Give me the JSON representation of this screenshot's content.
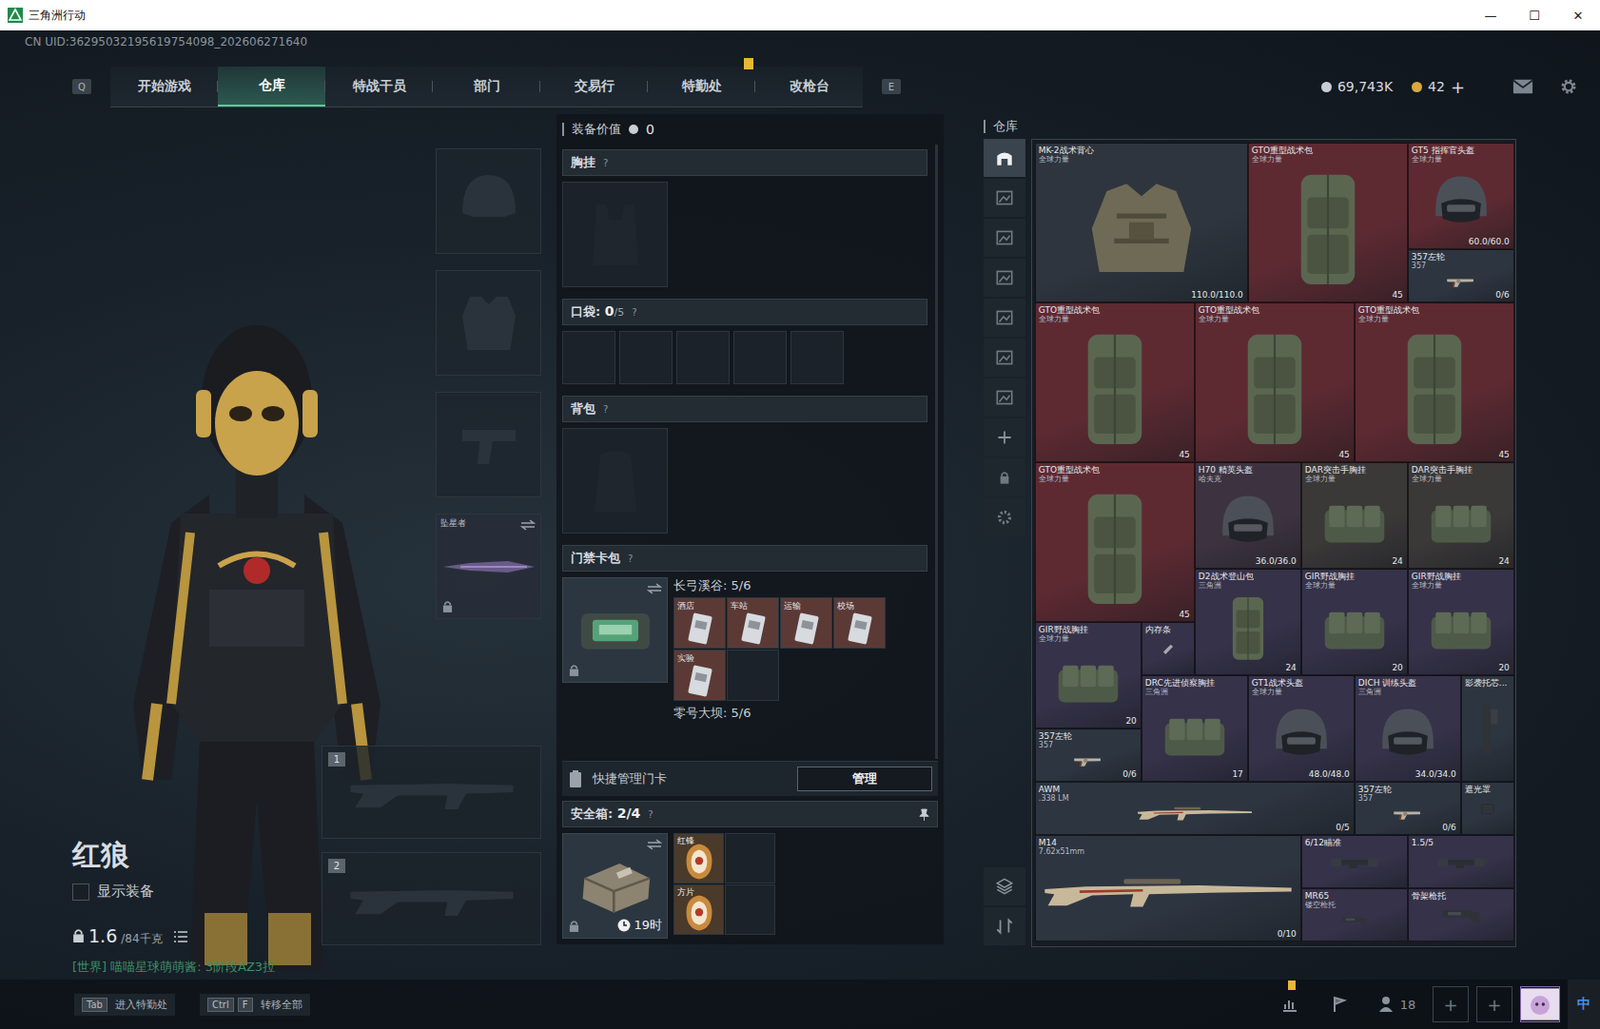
{
  "window": {
    "title": "三角洲行动",
    "controls": [
      "—",
      "☐",
      "✕"
    ]
  },
  "uid": "CN UID:36295032195619754098_202606271640",
  "nav": {
    "keys": [
      "Q",
      "E"
    ],
    "tabs": [
      {
        "label": "开始游戏",
        "selected": false,
        "alert": false
      },
      {
        "label": "仓库",
        "selected": true,
        "alert": false
      },
      {
        "label": "特战干员",
        "selected": false,
        "alert": false
      },
      {
        "label": "部门",
        "selected": false,
        "alert": false
      },
      {
        "label": "交易行",
        "selected": false,
        "alert": false
      },
      {
        "label": "特勤处",
        "selected": false,
        "alert": true
      },
      {
        "label": "改枪台",
        "selected": false,
        "alert": false
      }
    ]
  },
  "currency": {
    "coins": "69,743K",
    "tickets": "42",
    "add": "+"
  },
  "character": {
    "name": "红狼",
    "show_equipment": {
      "label": "显示装备",
      "checked": false
    },
    "weight": "1.6",
    "weight_max": "/84千克",
    "chat": "[世界] 喵喵星球萌萌酱: 3阶段AZ3拉"
  },
  "equip_slots": [
    {
      "kind": "helmet",
      "label": "",
      "locked": false,
      "swap": false
    },
    {
      "kind": "armor",
      "label": "",
      "locked": false,
      "swap": false
    },
    {
      "kind": "pistol",
      "label": "",
      "locked": false,
      "swap": false
    },
    {
      "kind": "melee",
      "label": "坠星者",
      "locked": true,
      "swap": true
    }
  ],
  "weapon_slots": [
    {
      "number": "1"
    },
    {
      "number": "2"
    }
  ],
  "loadout": {
    "value_label": "装备价值",
    "value": "0",
    "chest": {
      "title": "胸挂",
      "help": "?"
    },
    "pockets": {
      "title": "口袋:",
      "count": "0",
      "max": "/5",
      "help": "?",
      "slots": 5
    },
    "backpack": {
      "title": "背包",
      "help": "?"
    },
    "keycards": {
      "title": "门禁卡包",
      "help": "?",
      "maps": [
        {
          "title": "长弓溪谷: 5/6",
          "cards": [
            {
              "label": "酒店",
              "owned": true
            },
            {
              "label": "车站",
              "owned": true
            },
            {
              "label": "运输",
              "owned": true
            },
            {
              "label": "校场",
              "owned": true
            },
            {
              "label": "实验",
              "owned": true
            },
            {
              "label": "",
              "owned": false
            }
          ]
        },
        {
          "title": "零号大坝: 5/6",
          "cards": []
        }
      ]
    },
    "quick": {
      "label": "快捷管理门卡",
      "button": "管理"
    },
    "safebox": {
      "title": "安全箱:",
      "count": "2/4",
      "help": "?",
      "timer": "19时",
      "items": [
        {
          "label": "红锋",
          "filled": true
        },
        {
          "label": "",
          "filled": false
        },
        {
          "label": "方片",
          "filled": true
        },
        {
          "label": "",
          "filled": false
        }
      ]
    }
  },
  "warehouse": {
    "title": "仓库",
    "tabs": [
      {
        "kind": "home",
        "selected": true
      },
      {
        "kind": "tab",
        "selected": false
      },
      {
        "kind": "tab",
        "selected": false
      },
      {
        "kind": "tab",
        "selected": false
      },
      {
        "kind": "tab",
        "selected": false
      },
      {
        "kind": "tab",
        "selected": false
      },
      {
        "kind": "tab",
        "selected": false
      },
      {
        "kind": "add",
        "selected": false
      },
      {
        "kind": "lock",
        "selected": false
      },
      {
        "kind": "settings",
        "selected": false
      }
    ],
    "items": [
      {
        "name": "MK-2战术背心",
        "sub": "全球力量",
        "stat": "110.0/110.0",
        "kind": "vest",
        "color": "#2e353e"
      },
      {
        "name": "GTO重型战术包",
        "sub": "全球力量",
        "stat": "45",
        "kind": "bag",
        "color": "#5e2a32"
      },
      {
        "name": "GT5 指挥官头盔",
        "sub": "全球力量",
        "stat": "60.0/60.0",
        "kind": "helmet",
        "color": "#5e2a32"
      },
      {
        "name": "357左轮",
        "sub": "357",
        "stat": "0/6",
        "kind": "pistol",
        "color": "#2d3540"
      },
      {
        "name": "GTO重型战术包",
        "sub": "全球力量",
        "stat": "45",
        "kind": "bag",
        "color": "#5e2a32"
      },
      {
        "name": "GTO重型战术包",
        "sub": "全球力量",
        "stat": "45",
        "kind": "bag",
        "color": "#5e2a32"
      },
      {
        "name": "GTO重型战术包",
        "sub": "全球力量",
        "stat": "45",
        "kind": "bag",
        "color": "#5e2a32"
      },
      {
        "name": "GTO重型战术包",
        "sub": "全球力量",
        "stat": "45",
        "kind": "bag",
        "color": "#5e2a32"
      },
      {
        "name": "H70 精英头盔",
        "sub": "哈夫克",
        "stat": "36.0/36.0",
        "kind": "helmet",
        "color": "#3d3340"
      },
      {
        "name": "DAR突击手胸挂",
        "sub": "全球力量",
        "stat": "24",
        "kind": "rig",
        "color": "#3b3838"
      },
      {
        "name": "DAR突击手胸挂",
        "sub": "全球力量",
        "stat": "24",
        "kind": "rig",
        "color": "#3b3838"
      },
      {
        "name": "D2战术登山包",
        "sub": "三角洲",
        "stat": "24",
        "kind": "bag",
        "color": "#363249"
      },
      {
        "name": "GIR野战胸挂",
        "sub": "全球力量",
        "stat": "20",
        "kind": "rig",
        "color": "#363249"
      },
      {
        "name": "GIR野战胸挂",
        "sub": "全球力量",
        "stat": "20",
        "kind": "rig",
        "color": "#363249"
      },
      {
        "name": "GIR野战胸挂",
        "sub": "全球力量",
        "stat": "20",
        "kind": "rig",
        "color": "#363249"
      },
      {
        "name": "内存条",
        "sub": "",
        "stat": "",
        "kind": "chip",
        "color": "#363249"
      },
      {
        "name": "DRC先进侦察胸挂",
        "sub": "三角洲",
        "stat": "17",
        "kind": "rig",
        "color": "#363249"
      },
      {
        "name": "GT1战术头盔",
        "sub": "全球力量",
        "stat": "48.0/48.0",
        "kind": "helmet",
        "color": "#363249"
      },
      {
        "name": "DICH 训练头盔",
        "sub": "三角洲",
        "stat": "34.0/34.0",
        "kind": "helmet",
        "color": "#363249"
      },
      {
        "name": "影袭托芯...",
        "sub": "",
        "stat": "",
        "kind": "grip",
        "color": "#2d3540"
      },
      {
        "name": "357左轮",
        "sub": "357",
        "stat": "0/6",
        "kind": "pistol",
        "color": "#2d3540"
      },
      {
        "name": "AWM",
        "sub": ".338 LM",
        "stat": "0/5",
        "kind": "rifle",
        "color": "#2d3540"
      },
      {
        "name": "357左轮",
        "sub": "357",
        "stat": "0/6",
        "kind": "pistol",
        "color": "#2d3540"
      },
      {
        "name": "遮光罩",
        "sub": "",
        "stat": "",
        "kind": "hood",
        "color": "#2d3540"
      },
      {
        "name": "M14",
        "sub": "7.62x51mm",
        "stat": "0/10",
        "kind": "rifle",
        "color": "#2d3540"
      },
      {
        "name": "6/12瞄准",
        "sub": "",
        "stat": "",
        "kind": "scope",
        "color": "#363249"
      },
      {
        "name": "1.5/5",
        "sub": "",
        "stat": "",
        "kind": "scope",
        "color": "#363249"
      },
      {
        "name": "MR65",
        "sub": "镂空枪托",
        "stat": "",
        "kind": "stock",
        "color": "#363249"
      },
      {
        "name": "骨架枪托",
        "sub": "",
        "stat": "",
        "kind": "stock",
        "color": "#363249"
      }
    ]
  },
  "bottom_bar": {
    "hints": [
      {
        "keys": [
          "Tab"
        ],
        "label": "进入特勤处"
      },
      {
        "keys": [
          "Ctrl",
          "F"
        ],
        "label": "转移全部"
      }
    ],
    "friends": "18",
    "tools_alert": true,
    "plus": [
      "+",
      "+"
    ],
    "ime": "中"
  }
}
